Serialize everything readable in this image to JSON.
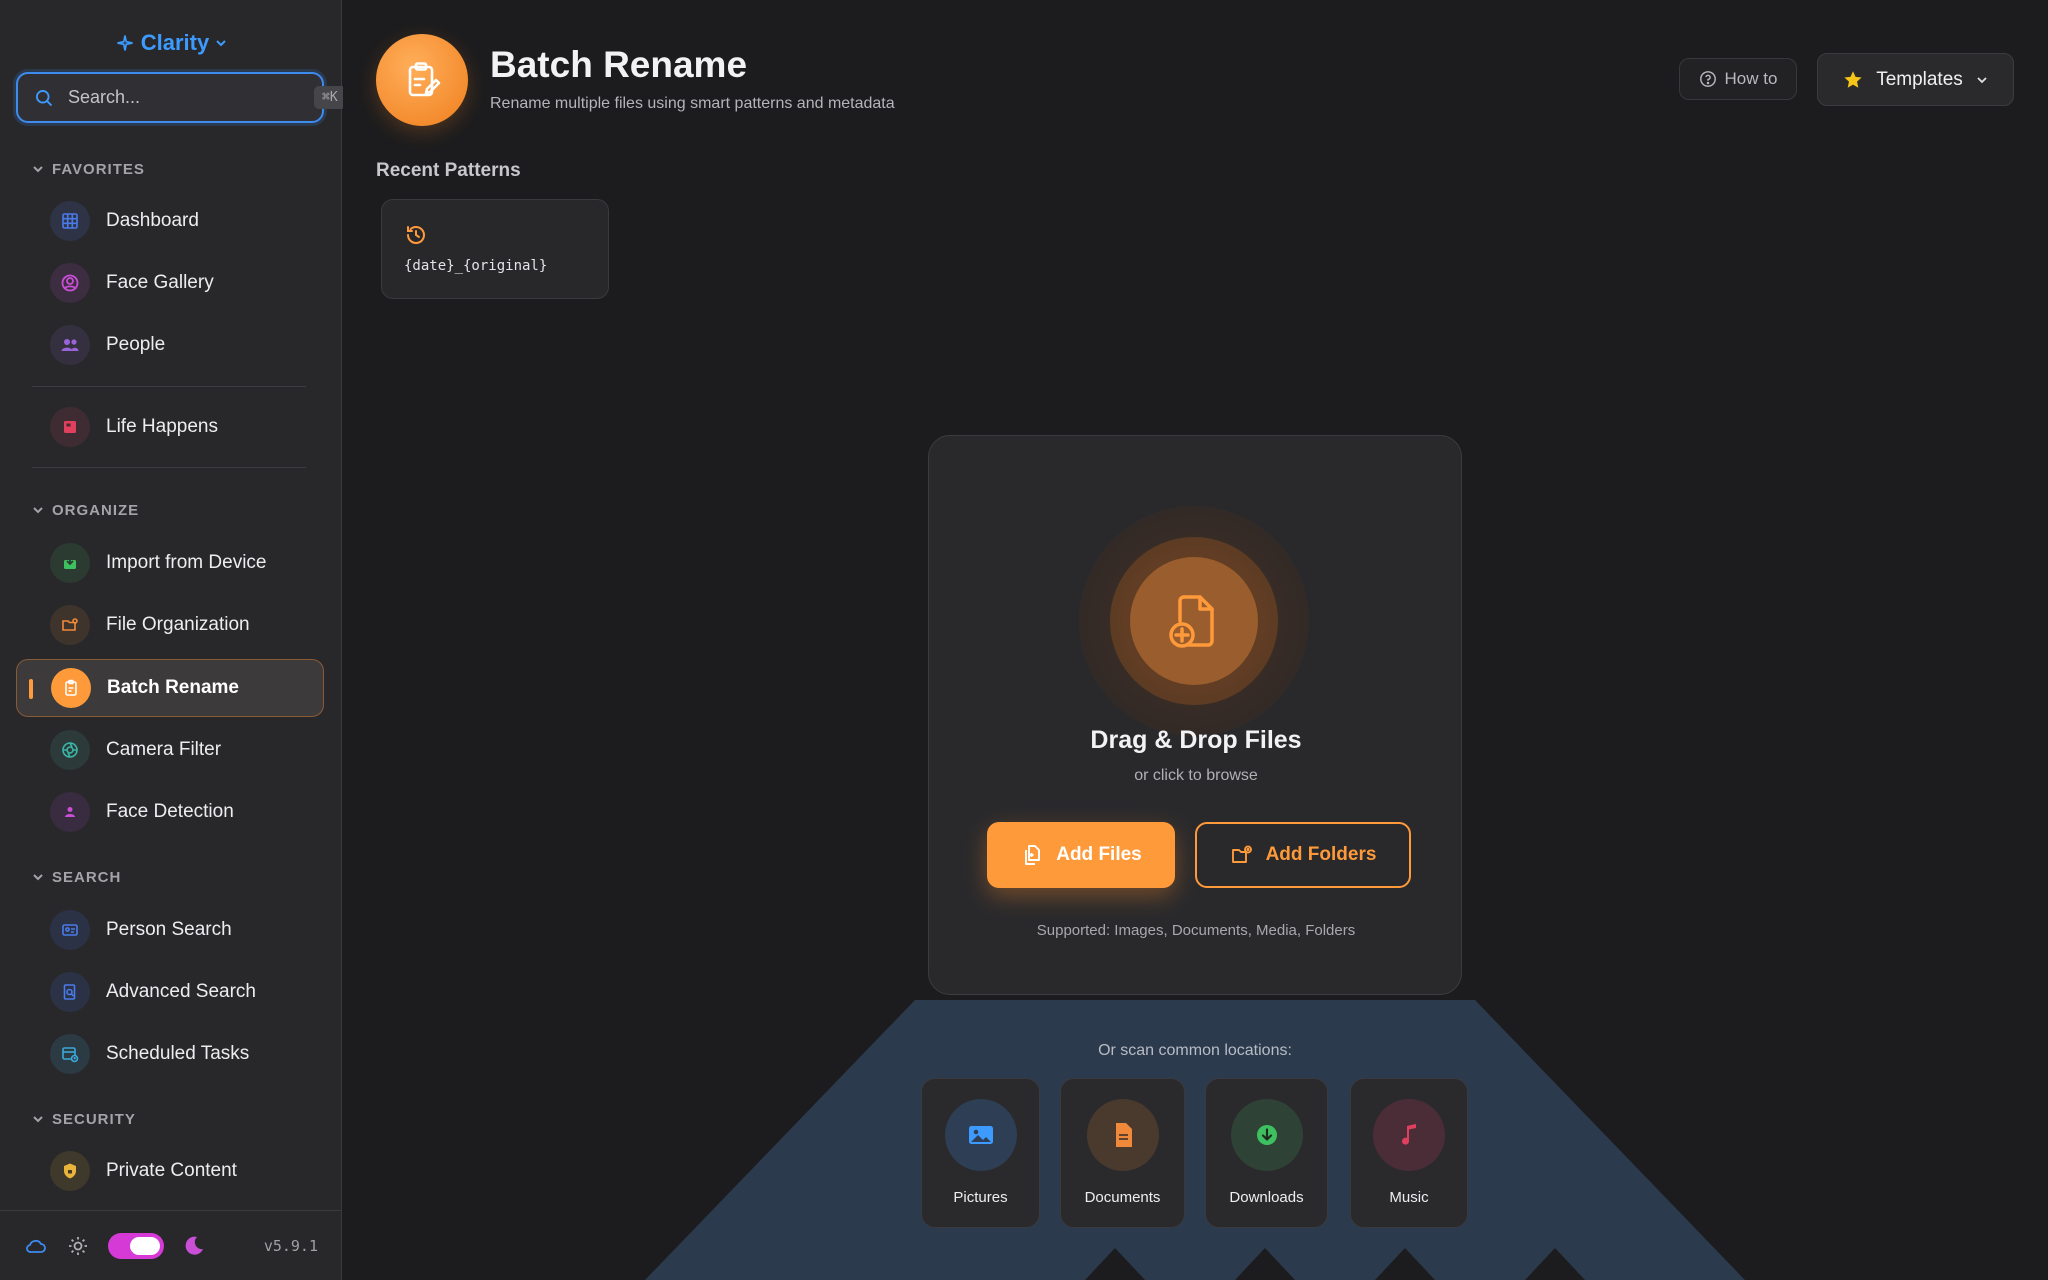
{
  "app": {
    "name": "Clarity",
    "version": "v5.9.1"
  },
  "search": {
    "placeholder": "Search...",
    "shortcut": "⌘K"
  },
  "sections": {
    "favorites": "FAVORITES",
    "organize": "ORGANIZE",
    "search": "SEARCH",
    "security": "SECURITY"
  },
  "nav": {
    "dashboard": "Dashboard",
    "face_gallery": "Face Gallery",
    "people": "People",
    "life_happens": "Life Happens",
    "import_device": "Import from Device",
    "file_org": "File Organization",
    "batch_rename": "Batch Rename",
    "camera_filter": "Camera Filter",
    "face_detection": "Face Detection",
    "person_search": "Person Search",
    "advanced_search": "Advanced Search",
    "scheduled_tasks": "Scheduled Tasks",
    "private_content": "Private Content"
  },
  "header": {
    "title": "Batch Rename",
    "subtitle": "Rename multiple files using smart patterns and metadata",
    "how_to": "How to",
    "templates": "Templates"
  },
  "recent": {
    "title": "Recent Patterns",
    "patterns": [
      "{date}_{original}"
    ]
  },
  "drop": {
    "title": "Drag & Drop Files",
    "subtitle": "or click to browse",
    "add_files": "Add Files",
    "add_folders": "Add Folders",
    "supported": "Supported: Images, Documents, Media, Folders"
  },
  "scan": {
    "label": "Or scan common locations:",
    "locations": [
      "Pictures",
      "Documents",
      "Downloads",
      "Music"
    ]
  },
  "colors": {
    "accent": "#ff9a3a",
    "brand": "#3d9bff",
    "sidebar_bg": "#28282b",
    "main_bg": "#1c1c1e",
    "scan_bg": "#2b3a4d"
  }
}
